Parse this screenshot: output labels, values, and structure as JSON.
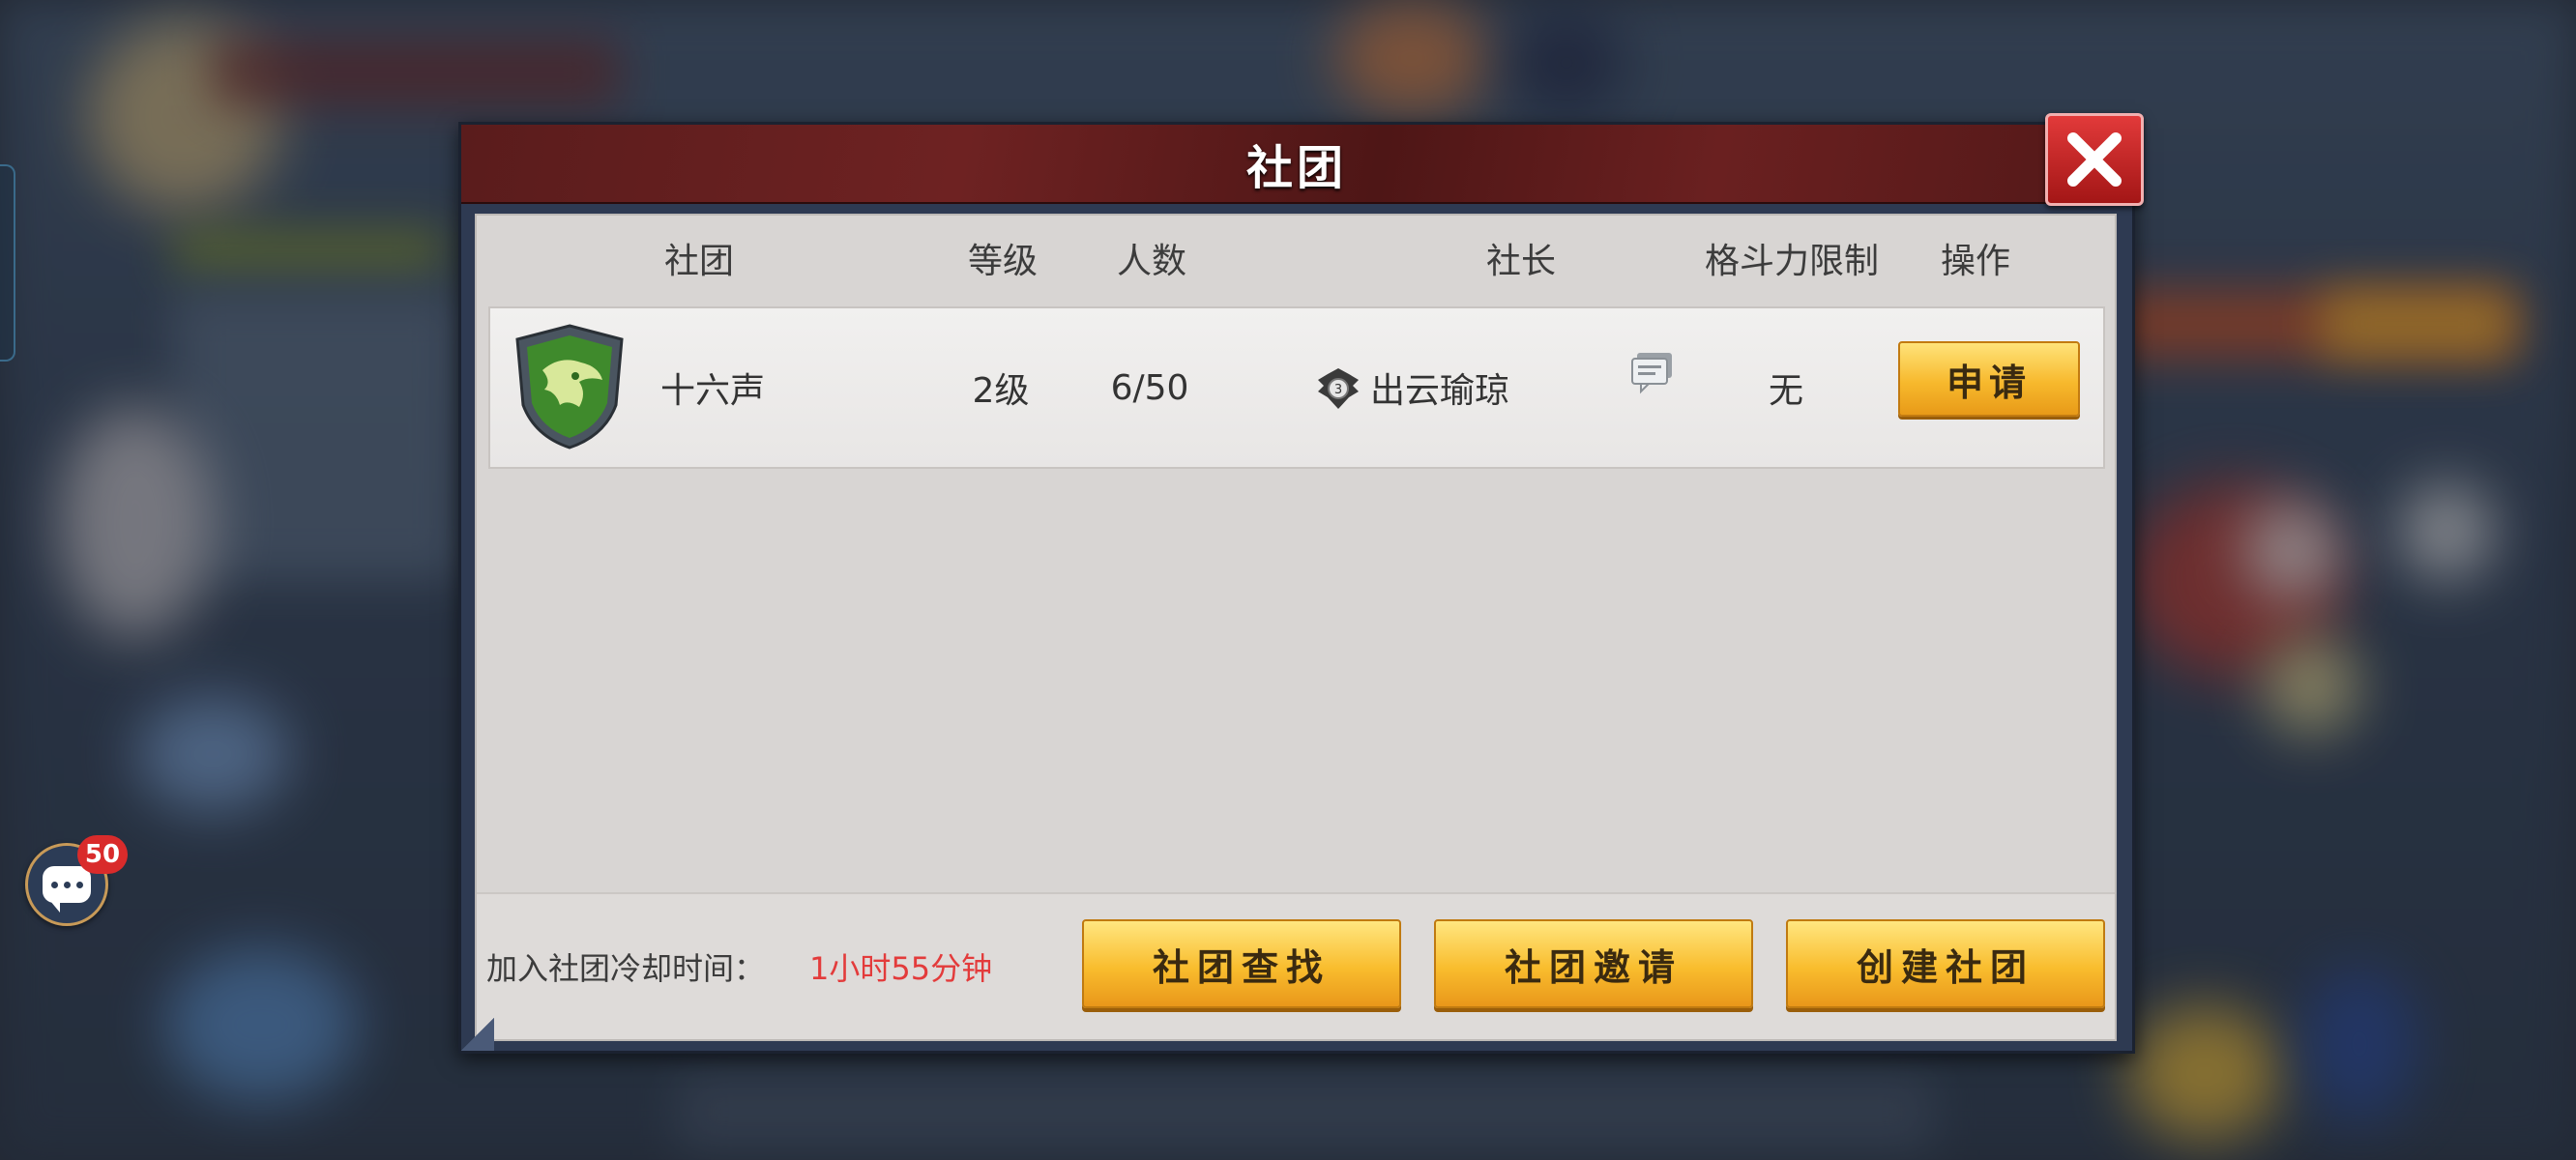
{
  "dialog": {
    "title": "社团",
    "columns": [
      "社团",
      "等级",
      "人数",
      "社长",
      "格斗力限制",
      "操作"
    ],
    "clubs": [
      {
        "name": "十六声",
        "level": "2级",
        "members": "6/50",
        "leader": "出云瑜琼",
        "power_limit": "无",
        "action": "申请"
      }
    ],
    "cooldown_label": "加入社团冷却时间：",
    "cooldown_value": "1小时55分钟",
    "buttons": {
      "search": "社团查找",
      "invite": "社团邀请",
      "create": "创建社团"
    }
  },
  "chat": {
    "badge": "50"
  },
  "colors": {
    "title_bar": "#6e2222",
    "leader_name": "#b8652a",
    "no_limit": "#8bc34a",
    "cooldown": "#e33b3b",
    "button_gold": "#f9bd2e"
  }
}
